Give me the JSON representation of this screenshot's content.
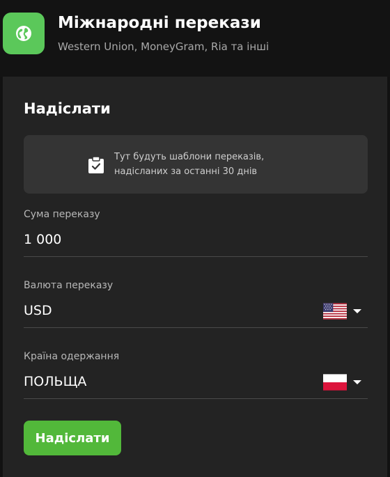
{
  "header": {
    "title": "Міжнародні перекази",
    "subtitle": "Western Union, MoneyGram, Ria та інші",
    "icon": "globe-icon",
    "icon_bg_color": "#5bc85a"
  },
  "form": {
    "title": "Надіслати",
    "templates_placeholder": {
      "icon": "clipboard-check-icon",
      "line1": "Тут будуть шаблони переказів,",
      "line2": "надісланих за останні 30 днів"
    },
    "amount": {
      "label": "Сума переказу",
      "value": "1 000"
    },
    "currency": {
      "label": "Валюта переказу",
      "value": "USD",
      "flag": "us-flag-icon"
    },
    "country": {
      "label": "Країна одержання",
      "value": "ПОЛЬЩА",
      "flag": "poland-flag-icon"
    },
    "submit_label": "Надіслати",
    "submit_color": "#52b83a"
  }
}
